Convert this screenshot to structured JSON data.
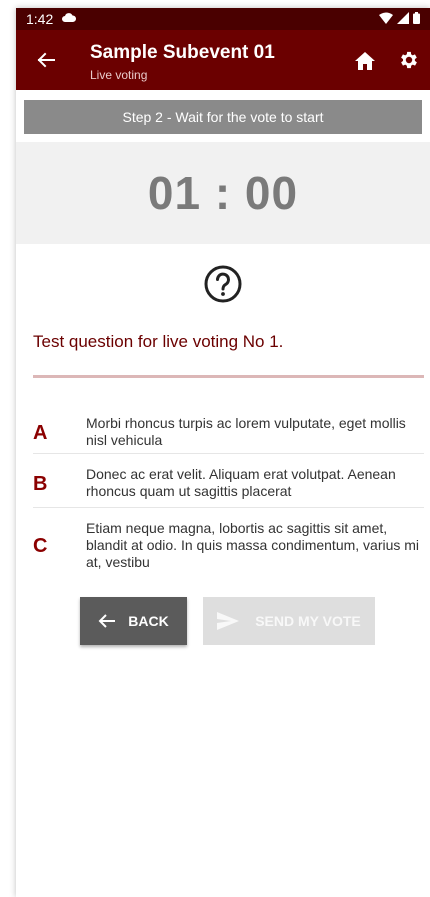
{
  "status_bar": {
    "time": "1:42"
  },
  "app_bar": {
    "title": "Sample Subevent 01",
    "subtitle": "Live voting"
  },
  "step_banner": {
    "text": "Step 2 - Wait for the vote to start"
  },
  "timer": {
    "value": "01 : 00"
  },
  "question": {
    "text": "Test question for live voting No 1."
  },
  "answers": [
    {
      "letter": "A",
      "text": "Morbi rhoncus turpis ac lorem vulputate, eget mollis nisl vehicula"
    },
    {
      "letter": "B",
      "text": "Donec ac erat velit. Aliquam erat volutpat. Aenean rhoncus quam ut sagittis placerat"
    },
    {
      "letter": "C",
      "text": "Etiam neque magna, lobortis ac sagittis sit amet, blandit at odio. In quis massa condimentum, varius mi at, vestibu"
    }
  ],
  "buttons": {
    "back_label": "BACK",
    "send_label": "SEND MY VOTE"
  },
  "colors": {
    "status_bar": "#4a0000",
    "app_bar": "#6b0000",
    "accent": "#8b0000",
    "banner": "#8a8a8a",
    "timer_bg": "#f1f1f1"
  },
  "icons": [
    "cloud-icon",
    "wifi-icon",
    "signal-icon",
    "battery-icon",
    "back-arrow-icon",
    "home-icon",
    "gear-icon",
    "help-circle-icon",
    "arrow-left-icon",
    "send-icon"
  ]
}
